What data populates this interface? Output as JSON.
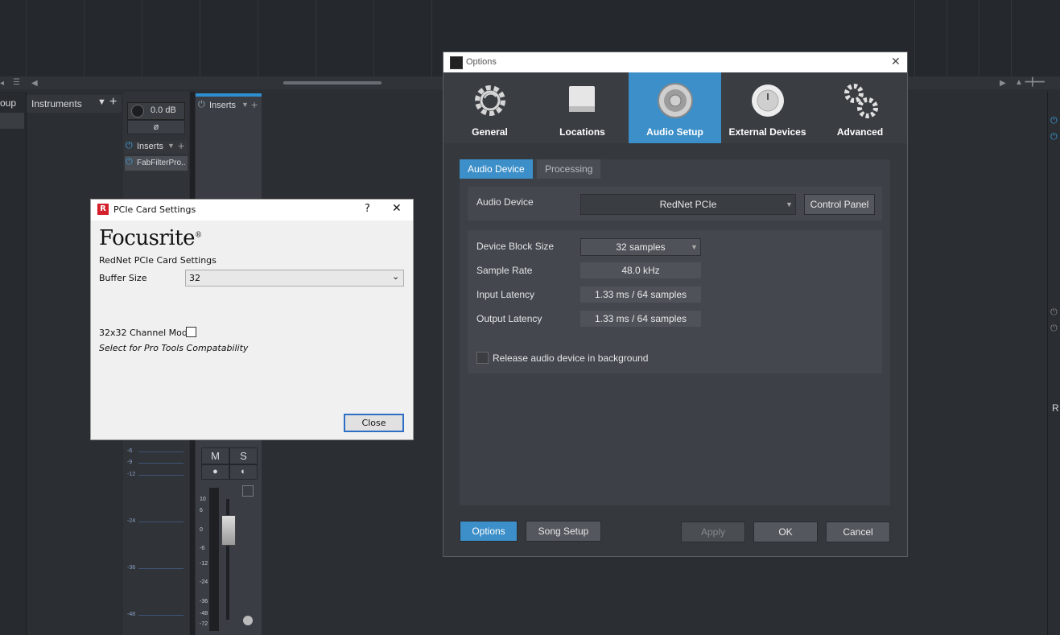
{
  "daw": {
    "left_label": "oup",
    "instruments_label": "Instruments",
    "channel_volume": "0.0 dB",
    "phase_symbol": "ø",
    "inserts_label": "Inserts",
    "insert_plugin": "FabFilterPro..",
    "mute_label": "M",
    "solo_label": "S",
    "right_edge_letter": "R",
    "meter_labels_1": [
      "-6",
      "-9",
      "-12",
      "-24",
      "-36",
      "-48"
    ],
    "meter_labels_2": [
      "10",
      "6",
      "0",
      "-6",
      "-12",
      "-24",
      "-36",
      "-48",
      "-72"
    ]
  },
  "pcie_dialog": {
    "title": "PCIe Card Settings",
    "help_glyph": "?",
    "close_glyph": "✕",
    "logo_text": "Focusrite",
    "logo_mark": "®",
    "subtitle": "RedNet PCIe Card Settings",
    "buffer_label": "Buffer Size",
    "buffer_value": "32",
    "channel_mode_label": "32x32 Channel Mode",
    "channel_mode_checked": false,
    "hint": "Select for Pro Tools Compatability",
    "close_button": "Close"
  },
  "options_dialog": {
    "title": "Options",
    "close_glyph": "✕",
    "tabs": [
      {
        "label": "General",
        "icon": "gear-icon"
      },
      {
        "label": "Locations",
        "icon": "drive-icon"
      },
      {
        "label": "Audio Setup",
        "icon": "speaker-icon",
        "active": true
      },
      {
        "label": "External Devices",
        "icon": "knob-icon"
      },
      {
        "label": "Advanced",
        "icon": "gears-icon"
      }
    ],
    "subtabs": [
      "Audio Device",
      "Processing"
    ],
    "audio_device_label": "Audio Device",
    "audio_device_value": "RedNet PCIe",
    "control_panel_button": "Control Panel",
    "block_size_label": "Device Block Size",
    "block_size_value": "32 samples",
    "sample_rate_label": "Sample Rate",
    "sample_rate_value": "48.0 kHz",
    "input_latency_label": "Input Latency",
    "input_latency_value": "1.33 ms / 64 samples",
    "output_latency_label": "Output Latency",
    "output_latency_value": "1.33 ms / 64 samples",
    "release_label": "Release audio device in background",
    "release_checked": false,
    "footer": {
      "options": "Options",
      "song_setup": "Song Setup",
      "apply": "Apply",
      "ok": "OK",
      "cancel": "Cancel"
    }
  },
  "colors": {
    "accent": "#3c8fc8",
    "focusrite_red": "#d4202a"
  }
}
